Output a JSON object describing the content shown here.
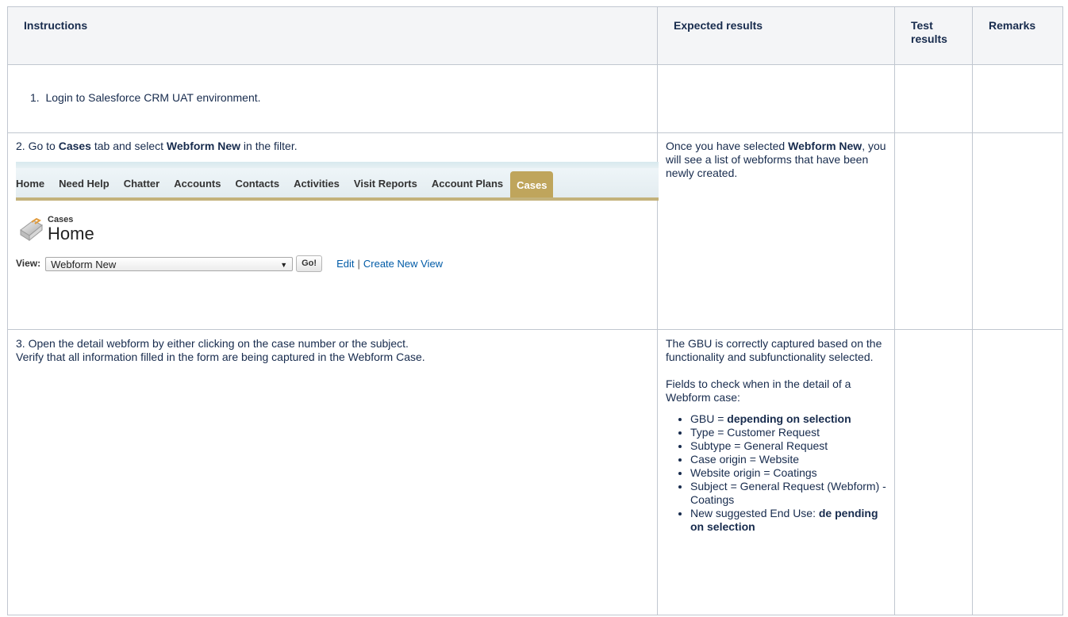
{
  "headers": {
    "instructions": "Instructions",
    "expected": "Expected results",
    "test_results": "Test results",
    "remarks": "Remarks"
  },
  "step1": {
    "number": "1.",
    "text": "Login to Salesforce CRM UAT environment."
  },
  "step2": {
    "prefix": "2. Go to ",
    "cases": "Cases",
    "middle": " tab and select ",
    "webform_new": "Webform New",
    "suffix": " in the filter.",
    "expected_prefix": "Once you have selected ",
    "expected_bold": "Webform New",
    "expected_suffix": ", you will see a list of webforms that have been newly created."
  },
  "salesforce": {
    "tabs": [
      "Home",
      "Need Help",
      "Chatter",
      "Accounts",
      "Contacts",
      "Activities",
      "Visit Reports",
      "Account Plans",
      "Cases"
    ],
    "active_tab": "Cases",
    "subtitle": "Cases",
    "title": "Home",
    "view_label": "View:",
    "view_value": "Webform New",
    "go_label": "Go!",
    "edit_link": "Edit",
    "separator": "|",
    "create_link": "Create New View"
  },
  "step3": {
    "line1": "3. Open the detail webform by either clicking on the case number or the subject.",
    "line2": "Verify that all information filled in the form are being captured in the Webform Case.",
    "expected_p1": "The GBU is correctly captured based on the functionality and subfunctionality selected.",
    "expected_p2": "Fields to check when in the detail of a Webform case:",
    "bullets": [
      {
        "text": "GBU = ",
        "bold": "depending on selection"
      },
      {
        "text": "Type = Customer Request",
        "bold": ""
      },
      {
        "text": "Subtype = General Request",
        "bold": ""
      },
      {
        "text": "Case origin = Website",
        "bold": ""
      },
      {
        "text": "Website origin = Coatings",
        "bold": ""
      },
      {
        "text": "Subject = General Request (Webform) - Coatings",
        "bold": ""
      },
      {
        "text": "New suggested End Use: ",
        "bold": "de pending on selection"
      }
    ]
  }
}
